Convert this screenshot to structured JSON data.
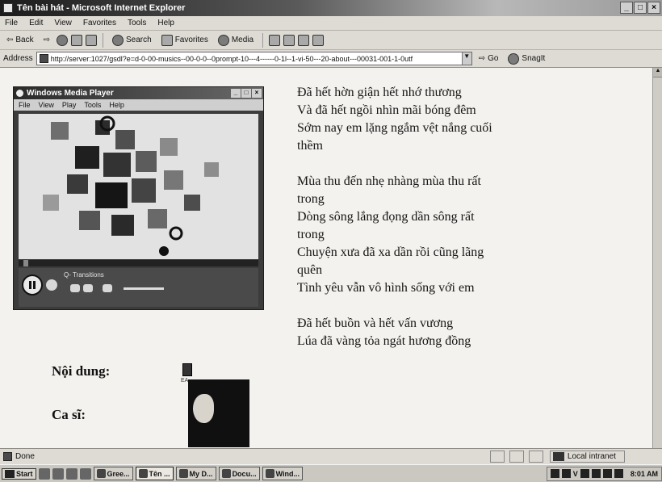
{
  "window": {
    "title": "Tên bài hát - Microsoft Internet Explorer",
    "buttons": [
      "_",
      "□",
      "×"
    ]
  },
  "menu": [
    "File",
    "Edit",
    "View",
    "Favorites",
    "Tools",
    "Help"
  ],
  "toolbar": {
    "back": "Back",
    "search": "Search",
    "favorites": "Favorites",
    "media": "Media"
  },
  "address": {
    "label": "Address",
    "url": "http://server:1027/gsdl?e=d-0-00-musics--00-0-0--0prompt-10---4------0-1l--1-vi-50---20-about---00031-001-1-0utf",
    "go": "Go",
    "snagit": "SnagIt"
  },
  "player": {
    "title": "Windows Media Player",
    "menu": [
      "File",
      "View",
      "Play",
      "Tools",
      "Help"
    ],
    "status": "Q- Transitions"
  },
  "lyrics": [
    [
      "Đã hết hờn giận hết nhớ thương",
      "Và đã hết ngồi nhìn mãi bóng đêm",
      "Sớm nay em lặng ngắm vệt nắng cuối",
      "thềm"
    ],
    [
      "Mùa thu đến nhẹ nhàng mùa thu rất",
      "trong",
      "Dòng sông lắng đọng dần sông rất",
      "trong",
      "Chuyện xưa đã xa dần rồi cũng lãng",
      "quên",
      "Tình yêu vẫn vô hình sống với em"
    ],
    [
      "Đã hết buồn và hết vấn vương",
      "Lúa đã vàng tỏa ngát hương đồng"
    ]
  ],
  "fields": {
    "content_label": "Nội dung:",
    "singer_label": "Ca sĩ:",
    "audio_caption": "EA"
  },
  "status": {
    "text": "Done",
    "zone": "Local intranet"
  },
  "taskbar": {
    "start": "Start",
    "buttons": [
      "Gree...",
      "Tên ...",
      "My D...",
      "Docu...",
      "Wind..."
    ],
    "tray_text": "V",
    "clock": "8:01 AM"
  }
}
